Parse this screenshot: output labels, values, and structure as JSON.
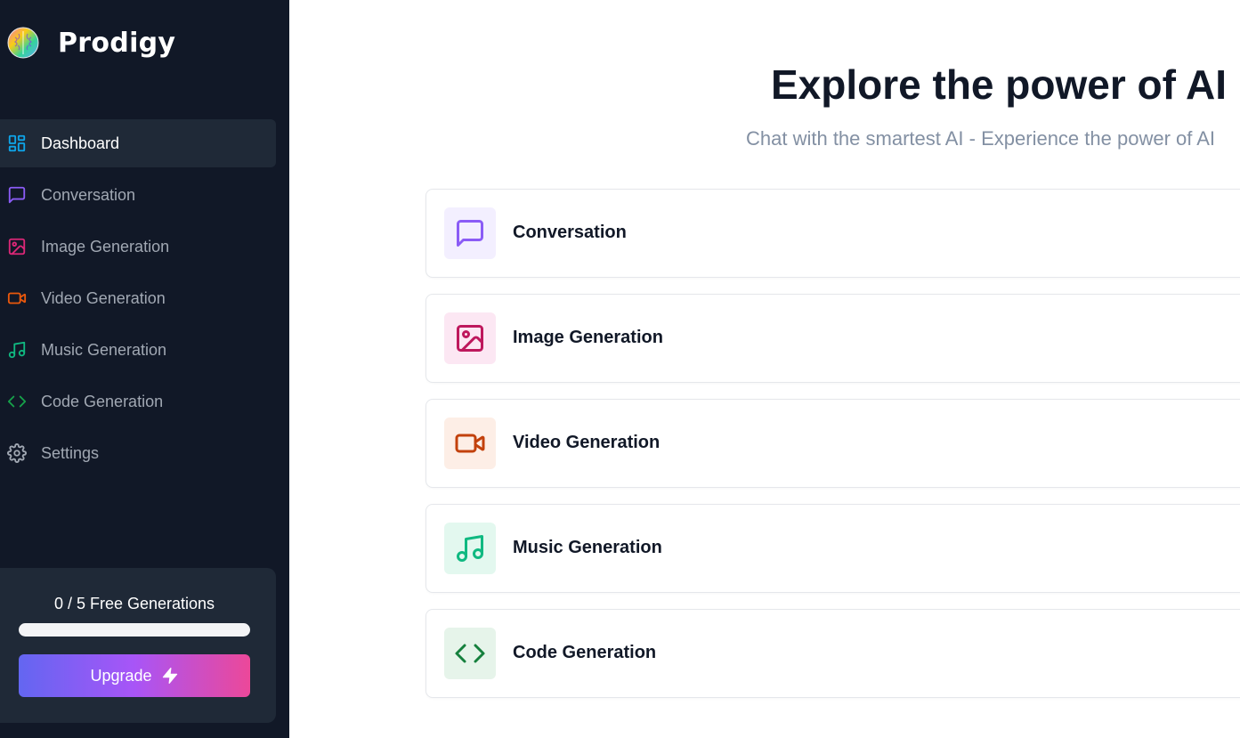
{
  "brand": {
    "name": "Prodigy",
    "logo_icon": "brain-logo-icon"
  },
  "sidebar": {
    "items": [
      {
        "label": "Dashboard",
        "icon": "dashboard-icon",
        "color": "#0ea5e9",
        "active": true
      },
      {
        "label": "Conversation",
        "icon": "message-square-icon",
        "color": "#8b5cf6"
      },
      {
        "label": "Image Generation",
        "icon": "image-icon",
        "color": "#db2777"
      },
      {
        "label": "Video Generation",
        "icon": "video-icon",
        "color": "#ea580c"
      },
      {
        "label": "Music Generation",
        "icon": "music-icon",
        "color": "#10b981"
      },
      {
        "label": "Code Generation",
        "icon": "code-icon",
        "color": "#16a34a"
      },
      {
        "label": "Settings",
        "icon": "gear-icon",
        "color": "#a1a8b3"
      }
    ]
  },
  "usage": {
    "text": "0 / 5 Free Generations",
    "used": 0,
    "limit": 5,
    "progress_fraction": 0
  },
  "upgrade": {
    "label": "Upgrade",
    "icon": "zap-icon"
  },
  "main": {
    "title": "Explore the power of AI",
    "subtitle": "Chat with the smartest AI - Experience the power of AI",
    "tools": [
      {
        "label": "Conversation",
        "icon": "message-square-icon",
        "color": "#8b5cf6",
        "bg": "#f3efff"
      },
      {
        "label": "Image Generation",
        "icon": "image-icon",
        "color": "#be185d",
        "bg": "#fce7f3"
      },
      {
        "label": "Video Generation",
        "icon": "video-icon",
        "color": "#c2410c",
        "bg": "#fdeee6"
      },
      {
        "label": "Music Generation",
        "icon": "music-icon",
        "color": "#10b981",
        "bg": "#e3f8ef"
      },
      {
        "label": "Code Generation",
        "icon": "code-icon",
        "color": "#15803d",
        "bg": "#e6f4ea"
      }
    ]
  }
}
